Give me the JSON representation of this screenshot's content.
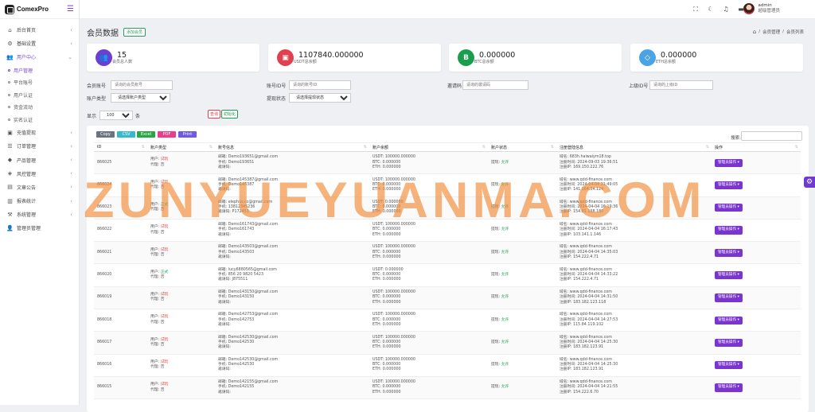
{
  "brand": "ComexPro",
  "sidebar": {
    "items": [
      {
        "label": "后台首页",
        "icon": "home-icon",
        "glyph": "⌂",
        "arrow": "‹"
      },
      {
        "label": "基础设置",
        "icon": "gear-icon",
        "glyph": "⚙",
        "arrow": "‹"
      },
      {
        "label": "用户中心",
        "icon": "users-icon",
        "glyph": "👥",
        "arrow": "⌄",
        "open": true
      },
      {
        "label": "用户管理",
        "sub": true,
        "active": true
      },
      {
        "label": "平台账号",
        "sub": true
      },
      {
        "label": "用户认证",
        "sub": true
      },
      {
        "label": "资金流动",
        "sub": true
      },
      {
        "label": "实名认证",
        "sub": true
      },
      {
        "label": "充值提现",
        "icon": "wallet-icon",
        "glyph": "▣",
        "arrow": "‹"
      },
      {
        "label": "订单管理",
        "icon": "cart-icon",
        "glyph": "☰",
        "arrow": "‹"
      },
      {
        "label": "产品管理",
        "icon": "box-icon",
        "glyph": "◆",
        "arrow": "‹"
      },
      {
        "label": "风控管理",
        "icon": "shield-icon",
        "glyph": "◈",
        "arrow": "‹"
      },
      {
        "label": "文章公告",
        "icon": "article-icon",
        "glyph": "▤",
        "arrow": "‹"
      },
      {
        "label": "报表统计",
        "icon": "chart-icon",
        "glyph": "▥",
        "arrow": "‹"
      },
      {
        "label": "系统管理",
        "icon": "system-icon",
        "glyph": "⚒",
        "arrow": "‹"
      },
      {
        "label": "管理员管理",
        "icon": "admin-icon",
        "glyph": "👤",
        "arrow": ""
      }
    ]
  },
  "topbar": {
    "user_name": "admin",
    "user_role": "超级管理员"
  },
  "page": {
    "title": "会员数据",
    "add_label": "添加会员",
    "breadcrumb": [
      "会员管理",
      "/",
      "会员列表"
    ]
  },
  "stats": [
    {
      "value": "15",
      "label": "会员总人数",
      "color": "#6a3fd1",
      "glyph": "👥",
      "icon": "members-icon"
    },
    {
      "value": "1107840.000000",
      "label": "USDT总余额",
      "color": "#e0414f",
      "glyph": "▣",
      "icon": "wallet-icon"
    },
    {
      "value": "0.000000",
      "label": "BTC总余额",
      "color": "#1a9e4e",
      "glyph": "B",
      "icon": "bitcoin-icon"
    },
    {
      "value": "0.000000",
      "label": "ETH总余额",
      "color": "#4aa3e6",
      "glyph": "◇",
      "icon": "diamond-icon"
    }
  ],
  "filters": {
    "member_account_label": "会员账号",
    "member_account_placeholder": "请询的会员账号",
    "account_id_label": "账号ID号",
    "account_id_placeholder": "请询的账号ID",
    "invite_label": "邀请码",
    "invite_placeholder": "请询的邀请码",
    "parent_id_label": "上级ID号",
    "parent_id_placeholder": "请询的上级ID",
    "account_type_label": "账户类型",
    "account_type_value": "请选择账户类型",
    "withdraw_label": "提现状态",
    "withdraw_value": "请选择提现状态",
    "show_label": "显示",
    "show_value": "100",
    "show_unit": "条",
    "query_btn": "查询",
    "reset_btn": "初始化"
  },
  "export_buttons": [
    {
      "label": "Copy",
      "color": "#6c757d"
    },
    {
      "label": "CSV",
      "color": "#36b9cc"
    },
    {
      "label": "Excel",
      "color": "#28a745"
    },
    {
      "label": "PDF",
      "color": "#e83e8c"
    },
    {
      "label": "Print",
      "color": "#6f5ae6"
    }
  ],
  "search_label": "搜索:",
  "table": {
    "headers": [
      "ID",
      "账户类型",
      "账号信息",
      "账户余额",
      "账户状态",
      "注册登陆信息",
      "操作"
    ],
    "rows": [
      {
        "id": "866025",
        "user": "试玩",
        "agent": "否",
        "email": "Demo193651@gmail.com",
        "phone": "Demo193651",
        "invite": "",
        "usdt": "100000.000000",
        "btc": "0.000000",
        "eth": "0.000000",
        "withdraw": "允许",
        "domain": "683h.haiwaiym18.top",
        "reg": "2024-09-03 19:36:51",
        "ip": "169.150.222.76"
      },
      {
        "id": "866024",
        "user": "试玩",
        "agent": "否",
        "email": "Demo145387@gmail.com",
        "phone": "Demo145387",
        "invite": "",
        "usdt": "100000.000000",
        "btc": "0.000000",
        "eth": "0.000000",
        "withdraw": "允许",
        "domain": "www.qdd-finance.com",
        "reg": "2024-04-04 21:49:05",
        "ip": "141.164.34.124"
      },
      {
        "id": "866023",
        "user": "正式",
        "agent": "否",
        "email": "elephus.cc@gmail.com",
        "phone": "13812345236",
        "invite": "P172453",
        "usdt": "0.000000",
        "btc": "0.000000",
        "eth": "0.000000",
        "withdraw": "允许",
        "domain": "www.qdd-finance.com",
        "reg": "2024-04-04 16:19:36",
        "ip": "154.81.138.180"
      },
      {
        "id": "866022",
        "user": "试玩",
        "agent": "否",
        "email": "Demo161743@gmail.com",
        "phone": "Demo161743",
        "invite": "",
        "usdt": "100000.000000",
        "btc": "0.000000",
        "eth": "0.000000",
        "withdraw": "允许",
        "domain": "www.qdd-finance.com",
        "reg": "2024-04-04 16:17:43",
        "ip": "103.141.1.146"
      },
      {
        "id": "866021",
        "user": "试玩",
        "agent": "否",
        "email": "Demo143503@gmail.com",
        "phone": "Demo143503",
        "invite": "",
        "usdt": "100000.000000",
        "btc": "0.000000",
        "eth": "0.000000",
        "withdraw": "允许",
        "domain": "www.qdd-finance.com",
        "reg": "2024-04-04 14:35:03",
        "ip": "154.222.4.71"
      },
      {
        "id": "866020",
        "user": "正式",
        "agent": "否",
        "email": "lucy6880565@gmail.com",
        "phone": "856 20 9820 5423",
        "invite": "J875511",
        "usdt": "0.000000",
        "btc": "0.000000",
        "eth": "0.000000",
        "withdraw": "允许",
        "domain": "www.qdd-finance.com",
        "reg": "2024-04-04 14:33:22",
        "ip": "154.222.4.71"
      },
      {
        "id": "866019",
        "user": "试玩",
        "agent": "否",
        "email": "Demo143150@gmail.com",
        "phone": "Demo143150",
        "invite": "",
        "usdt": "100000.000000",
        "btc": "0.000000",
        "eth": "0.000000",
        "withdraw": "允许",
        "domain": "www.qdd-finance.com",
        "reg": "2024-04-04 14:31:50",
        "ip": "183.182.123.118"
      },
      {
        "id": "866018",
        "user": "试玩",
        "agent": "否",
        "email": "Demo142753@gmail.com",
        "phone": "Demo142753",
        "invite": "",
        "usdt": "100000.000000",
        "btc": "0.000000",
        "eth": "0.000000",
        "withdraw": "允许",
        "domain": "www.qdd-finance.com",
        "reg": "2024-04-04 14:27:53",
        "ip": "115.84.119.102"
      },
      {
        "id": "866017",
        "user": "试玩",
        "agent": "否",
        "email": "Demo142530@gmail.com",
        "phone": "Demo142530",
        "invite": "",
        "usdt": "100000.000000",
        "btc": "0.000000",
        "eth": "0.000000",
        "withdraw": "允许",
        "domain": "www.qdd-finance.com",
        "reg": "2024-04-04 14:25:30",
        "ip": "183.182.123.91"
      },
      {
        "id": "866016",
        "user": "试玩",
        "agent": "否",
        "email": "Demo142530@gmail.com",
        "phone": "Demo142530",
        "invite": "",
        "usdt": "100000.000000",
        "btc": "0.000000",
        "eth": "0.000000",
        "withdraw": "允许",
        "domain": "www.qdd-finance.com",
        "reg": "2024-04-04 14:25:30",
        "ip": "183.182.123.91"
      },
      {
        "id": "866015",
        "user": "试玩",
        "agent": "否",
        "email": "Demo142155@gmail.com",
        "phone": "Demo142155",
        "invite": "",
        "usdt": "100000.000000",
        "btc": "0.000000",
        "eth": "0.000000",
        "withdraw": "允许",
        "domain": "www.qdd-finance.com",
        "reg": "2024-04-04 14:21:55",
        "ip": "154.222.6.70"
      }
    ],
    "labels": {
      "user": "用户:",
      "agent": "代理:",
      "email": "邮箱:",
      "phone": "手机:",
      "invite": "邀请码:",
      "usdt": "USDT:",
      "btc": "BTC:",
      "eth": "ETH:",
      "withdraw": "提现:",
      "domain": "域名:",
      "reg": "注册时间:",
      "ip": "注册IP:"
    },
    "action_label": "管理员操作"
  },
  "watermark": "ZUNYUEYUANMA.COM"
}
